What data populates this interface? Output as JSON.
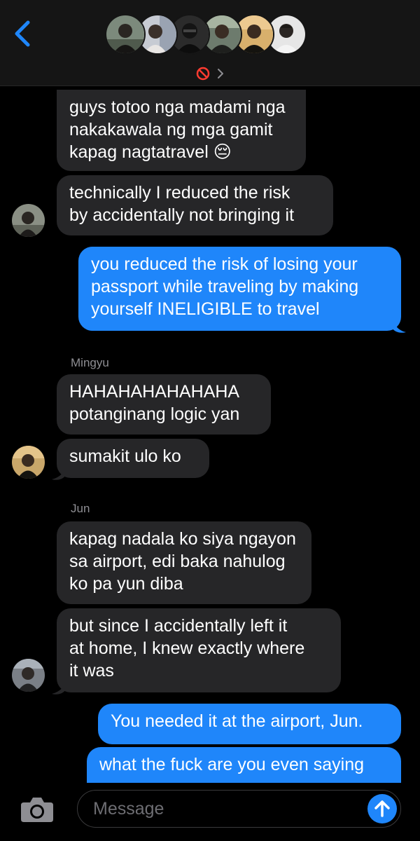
{
  "colors": {
    "accent": "#1f86fa",
    "received_bubble": "#262628",
    "background": "#000000",
    "header": "#151515",
    "muted_text": "#8e8e93",
    "danger_icon": "#ff3b30"
  },
  "header": {
    "back_icon": "chevron-left-icon",
    "group_info_icons": [
      "prohibited-icon",
      "chevron-right-icon"
    ],
    "participant_count": 6
  },
  "messages": [
    {
      "from": "other",
      "text": "guys totoo nga madami nga\nnakakawala ng mga gamit\nkapag nagtatravel 😔"
    },
    {
      "from": "other",
      "text": "technically I reduced the risk\nby accidentally not bringing it"
    },
    {
      "from": "me",
      "text": "you reduced the risk of losing your\npassport while traveling by making\nyourself INELIGIBLE to travel"
    },
    {
      "sender": "Mingyu"
    },
    {
      "from": "other",
      "text": "HAHAHAHAHAHAHA\npotanginang logic yan"
    },
    {
      "from": "other",
      "text": "sumakit ulo ko"
    },
    {
      "sender": "Jun"
    },
    {
      "from": "other",
      "text": "kapag nadala ko siya ngayon\nsa airport, edi baka nahulog\nko pa yun diba"
    },
    {
      "from": "other",
      "text": "but since I accidentally left it\nat home, I knew exactly where\nit was"
    },
    {
      "from": "me",
      "text": "You needed it at the airport, Jun."
    },
    {
      "from": "me",
      "text": "what the fuck are you even saying"
    }
  ],
  "composer": {
    "placeholder": "Message",
    "camera_icon": "camera-icon",
    "send_icon": "arrow-up-icon"
  }
}
